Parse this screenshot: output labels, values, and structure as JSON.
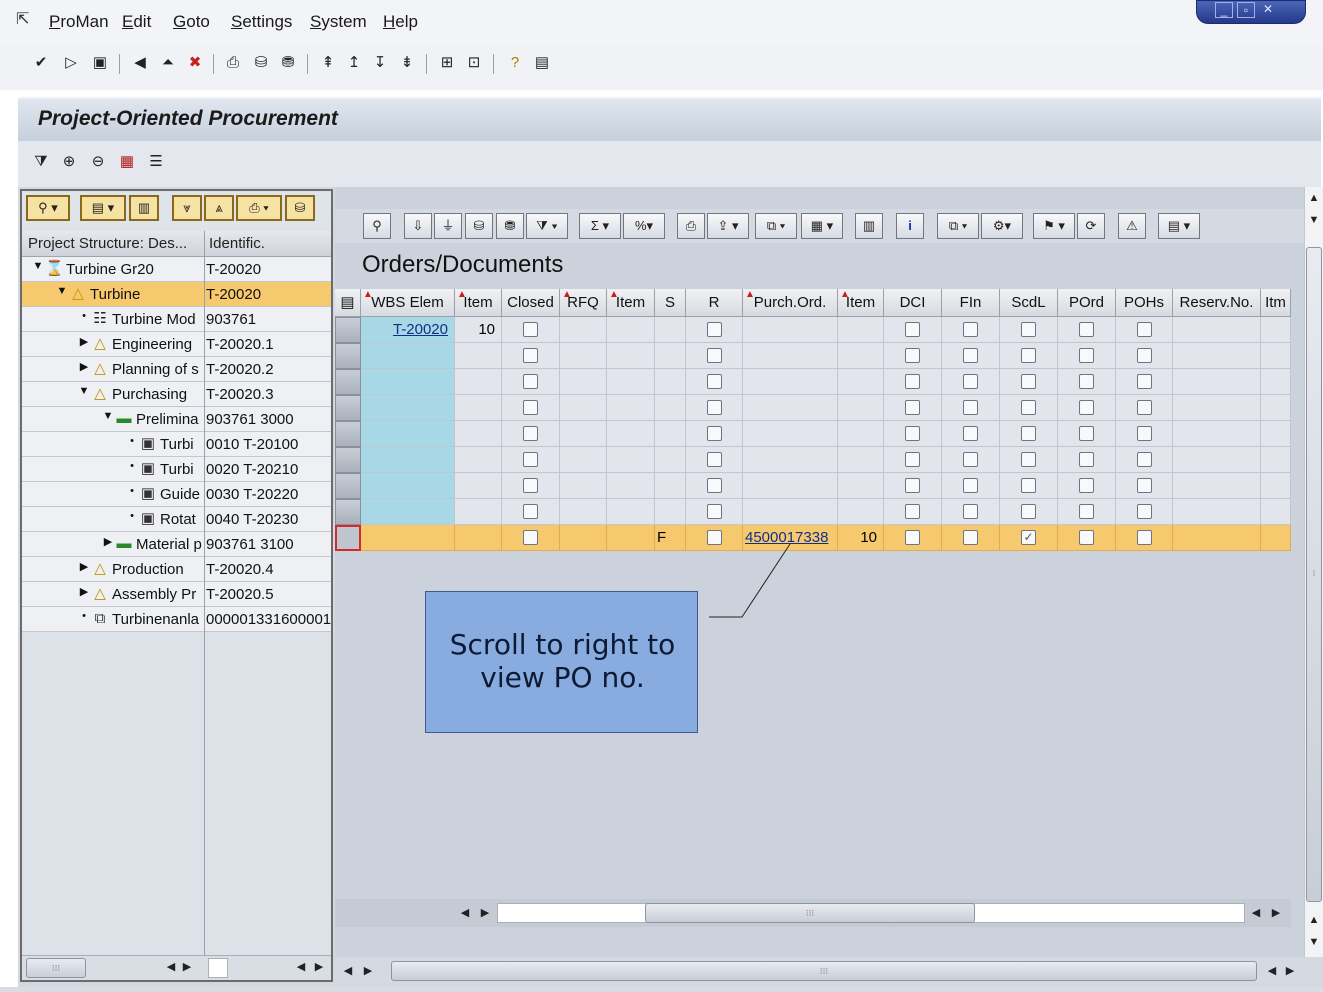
{
  "menu": {
    "items": [
      "ProMan",
      "Edit",
      "Goto",
      "Settings",
      "System",
      "Help"
    ]
  },
  "window_controls": [
    "minimize-icon",
    "restore-icon",
    "close-icon"
  ],
  "standard_toolbar": {
    "icons": [
      "enter-icon",
      "command-field-arrow-icon",
      "save-icon",
      "back-icon",
      "exit-icon",
      "cancel-icon",
      "print-icon",
      "find-icon",
      "find-next-icon",
      "first-page-icon",
      "previous-page-icon",
      "next-page-icon",
      "last-page-icon",
      "create-session-icon",
      "shortcut-icon",
      "help-icon",
      "customize-layout-icon"
    ]
  },
  "page_title": "Project-Oriented Procurement",
  "app_toolbar": {
    "icons": [
      "filter-icon",
      "expand-icon",
      "collapse-icon",
      "calendar-icon",
      "list-icon"
    ]
  },
  "tree": {
    "toolbar_icons": [
      "person-icon",
      "expand-node-icon",
      "collapse-node-icon",
      "sort-down-icon",
      "sort-up-icon",
      "print-icon",
      "find-icon"
    ],
    "header": {
      "col1": "Project Structure: Des...",
      "col2": "Identific."
    },
    "rows": [
      {
        "label": "Turbine Gr20",
        "id": "T-20020",
        "expander": "▼",
        "icon": "project-icon",
        "level": 0,
        "selected": false
      },
      {
        "label": "Turbine",
        "id": "T-20020",
        "expander": "▼",
        "icon": "wbs-triangle-icon",
        "level": 1,
        "selected": true
      },
      {
        "label": "Turbine Mod",
        "id": "903761",
        "expander": "•",
        "icon": "network-icon",
        "level": 2,
        "selected": false
      },
      {
        "label": "Engineering",
        "id": "T-20020.1",
        "expander": "▶",
        "icon": "wbs-triangle-icon",
        "level": 2,
        "selected": false
      },
      {
        "label": "Planning of s",
        "id": "T-20020.2",
        "expander": "▶",
        "icon": "wbs-triangle-icon",
        "level": 2,
        "selected": false
      },
      {
        "label": "Purchasing",
        "id": "T-20020.3",
        "expander": "▼",
        "icon": "wbs-triangle-icon",
        "level": 2,
        "selected": false
      },
      {
        "label": "Prelimina",
        "id": "903761 3000",
        "expander": "▼",
        "icon": "activity-icon",
        "level": 3,
        "selected": false
      },
      {
        "label": "Turbi",
        "id": "0010 T-20100",
        "expander": "•",
        "icon": "material-icon",
        "level": 4,
        "selected": false
      },
      {
        "label": "Turbi",
        "id": "0020 T-20210",
        "expander": "•",
        "icon": "material-icon",
        "level": 4,
        "selected": false
      },
      {
        "label": "Guide",
        "id": "0030 T-20220",
        "expander": "•",
        "icon": "material-icon",
        "level": 4,
        "selected": false
      },
      {
        "label": "Rotat",
        "id": "0040 T-20230",
        "expander": "•",
        "icon": "material-icon",
        "level": 4,
        "selected": false
      },
      {
        "label": "Material p",
        "id": "903761 3100",
        "expander": "▶",
        "icon": "activity-icon",
        "level": 3,
        "selected": false
      },
      {
        "label": "Production",
        "id": "T-20020.4",
        "expander": "▶",
        "icon": "wbs-triangle-icon",
        "level": 2,
        "selected": false
      },
      {
        "label": "Assembly Pr",
        "id": "T-20020.5",
        "expander": "▶",
        "icon": "wbs-triangle-icon",
        "level": 2,
        "selected": false
      },
      {
        "label": "Turbinenanla",
        "id": "000001331600001",
        "expander": "•",
        "icon": "equipment-icon",
        "level": 2,
        "selected": false
      }
    ]
  },
  "grid": {
    "title": "Orders/Documents",
    "toolbar_icons": [
      "details-icon",
      "print-preview-icon",
      "filter-icon",
      "find-icon",
      "find-next-icon",
      "set-filter-icon",
      "sum-icon",
      "subtotal-icon",
      "print-icon",
      "export-icon",
      "local-file-icon",
      "layout-icon",
      "chart-icon",
      "info-icon",
      "copy-icon",
      "analysis-icon",
      "flag-icon",
      "refresh-icon",
      "alert-icon",
      "document-icon"
    ],
    "columns": [
      "WBS Elem",
      "Item",
      "Closed",
      "RFQ",
      "Item",
      "S",
      "R",
      "Purch.Ord.",
      "Item",
      "DCI",
      "FIn",
      "ScdL",
      "POrd",
      "POHs",
      "Reserv.No.",
      "Itm"
    ],
    "rows": [
      {
        "wbs": "T-20020",
        "item": "10",
        "s": "",
        "purch_ord": "",
        "po_item": "",
        "scdl_checked": false,
        "highlight": false
      },
      {
        "wbs": "",
        "item": "",
        "s": "",
        "purch_ord": "",
        "po_item": "",
        "scdl_checked": false,
        "highlight": false
      },
      {
        "wbs": "",
        "item": "",
        "s": "",
        "purch_ord": "",
        "po_item": "",
        "scdl_checked": false,
        "highlight": false
      },
      {
        "wbs": "",
        "item": "",
        "s": "",
        "purch_ord": "",
        "po_item": "",
        "scdl_checked": false,
        "highlight": false
      },
      {
        "wbs": "",
        "item": "",
        "s": "",
        "purch_ord": "",
        "po_item": "",
        "scdl_checked": false,
        "highlight": false
      },
      {
        "wbs": "",
        "item": "",
        "s": "",
        "purch_ord": "",
        "po_item": "",
        "scdl_checked": false,
        "highlight": false
      },
      {
        "wbs": "",
        "item": "",
        "s": "",
        "purch_ord": "",
        "po_item": "",
        "scdl_checked": false,
        "highlight": false
      },
      {
        "wbs": "",
        "item": "",
        "s": "",
        "purch_ord": "",
        "po_item": "",
        "scdl_checked": false,
        "highlight": false
      },
      {
        "wbs": "",
        "item": "",
        "s": "F",
        "purch_ord": "4500017338",
        "po_item": "10",
        "scdl_checked": true,
        "highlight": true
      }
    ]
  },
  "callout": {
    "text": "Scroll to right to view PO no."
  },
  "colors": {
    "selection": "#f7c96f",
    "wbs_cell": "#a8d8e6",
    "callout": "#88acdf",
    "link": "#10308a"
  }
}
